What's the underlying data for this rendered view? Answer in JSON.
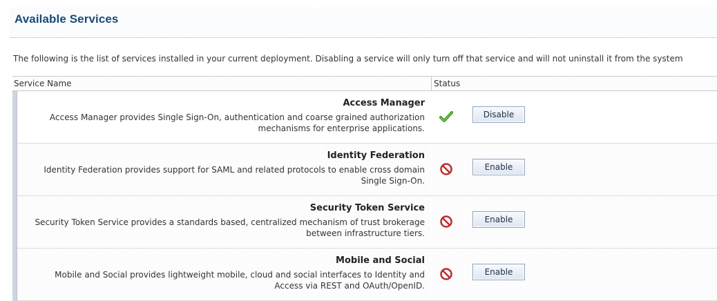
{
  "page": {
    "title": "Available Services",
    "intro": "The following is the list of services installed in your current deployment. Disabling a service will only turn off that service and will not uninstall it from the system"
  },
  "table": {
    "columns": [
      "Service Name",
      "Status"
    ],
    "rows": [
      {
        "name": "Access Manager",
        "description": "Access Manager provides Single Sign-On, authentication and coarse grained authorization mechanisms for enterprise applications.",
        "status_icon": "check-icon",
        "status_color": "#3a9a2a",
        "button_label": "Disable"
      },
      {
        "name": "Identity Federation",
        "description": "Identity Federation provides support for SAML and related protocols to enable cross domain Single Sign-On.",
        "status_icon": "disabled-icon",
        "status_color": "#c0282e",
        "button_label": "Enable"
      },
      {
        "name": "Security Token Service",
        "description": "Security Token Service provides a standards based, centralized mechanism of trust brokerage between infrastructure tiers.",
        "status_icon": "disabled-icon",
        "status_color": "#c0282e",
        "button_label": "Enable"
      },
      {
        "name": "Mobile and Social",
        "description": "Mobile and Social provides lightweight mobile, cloud and social interfaces to Identity and Access via REST and OAuth/OpenID.",
        "status_icon": "disabled-icon",
        "status_color": "#c0282e",
        "button_label": "Enable"
      }
    ]
  }
}
